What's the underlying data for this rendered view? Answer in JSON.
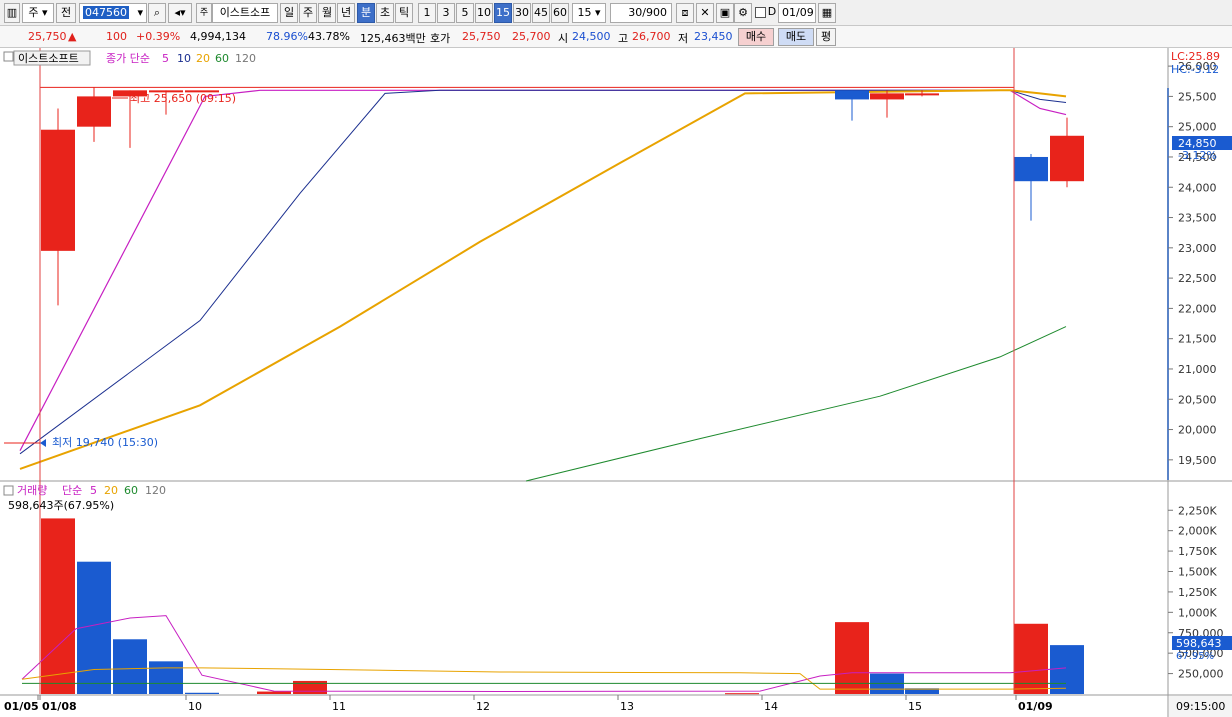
{
  "toolbar": {
    "type_select": "주",
    "prev_label": "전",
    "code_value": "047560",
    "stock_name": "이스트소프",
    "period_tabs": [
      "일",
      "주",
      "월",
      "년",
      "분",
      "초",
      "틱"
    ],
    "active_period": "분",
    "minute_intervals": [
      "1",
      "3",
      "5",
      "10",
      "15",
      "30",
      "45",
      "60"
    ],
    "active_interval": "15",
    "interval_select": "15",
    "count_display": "30/900",
    "date_checkbox_label": "D",
    "date_value": "01/09"
  },
  "quote": {
    "price": "25,750",
    "change": "100",
    "change_pct": "+0.39%",
    "volume": "4,994,134",
    "ratio1": "78.96%",
    "ratio2": "43.78%",
    "amount": "125,463백만",
    "bid_label": "호가",
    "ask_price": "25,750",
    "bid_price": "25,700",
    "open_label": "시",
    "open_price": "24,500",
    "high_label": "고",
    "high_price": "26,700",
    "low_label": "저",
    "low_price": "23,450",
    "buy_label": "매수",
    "sell_label": "매도",
    "eval_label": "평"
  },
  "price_panel": {
    "stock_tag": "이스트소프트",
    "legend_title": "종가 단순",
    "legend_periods": [
      "5",
      "10",
      "20",
      "60",
      "120"
    ],
    "lc_label": "LC:25.89",
    "hc_label": "HC:-3.12",
    "high_annotation": "최고 25,650 (09:15)",
    "low_annotation": "최저 19,740 (15:30)",
    "current_price_box": "24,850",
    "current_change_pct": "-3.12%",
    "y_ticks": [
      "26,000",
      "25,500",
      "25,000",
      "24,500",
      "24,000",
      "23,500",
      "23,000",
      "22,500",
      "22,000",
      "21,500",
      "21,000",
      "20,500",
      "20,000",
      "19,500"
    ]
  },
  "volume_panel": {
    "legend_title": "거래량",
    "legend_sub": "단순",
    "legend_periods": [
      "5",
      "20",
      "60",
      "120"
    ],
    "current_volume": "598,643주(67.95%)",
    "current_volume_box": "598,643",
    "current_volume_pct": "67.95%",
    "y_ticks": [
      "2,250K",
      "2,000K",
      "1,750K",
      "1,500K",
      "1,250K",
      "1,000K",
      "750,000",
      "500,000",
      "250,000"
    ]
  },
  "x_axis": {
    "labels": [
      "01/05",
      "01/08",
      "10",
      "11",
      "12",
      "13",
      "14",
      "15",
      "01/09"
    ],
    "time_label": "09:15:00"
  },
  "colors": {
    "up": "#e8231b",
    "down": "#1a5bd0",
    "ma5": "#c71fc2",
    "ma10": "#1b2f8f",
    "ma20": "#e8a300",
    "ma60": "#1e8a2e",
    "ma120": "#777777"
  },
  "chart_data": [
    {
      "type": "candlestick",
      "title": "이스트소프트",
      "y_range": [
        19200,
        26200
      ],
      "candles": [
        {
          "x": "01/08 09:00",
          "open": 22950,
          "high": 25300,
          "low": 22050,
          "close": 24950
        },
        {
          "x": "01/08 09:15",
          "open": 25000,
          "high": 25650,
          "low": 24750,
          "close": 25500
        },
        {
          "x": "01/08 09:30",
          "open": 25500,
          "high": 25600,
          "low": 24650,
          "close": 25600
        },
        {
          "x": "01/08 15:15",
          "open": 25600,
          "high": 25600,
          "low": 25200,
          "close": 25600
        },
        {
          "x": "01/08 15:30",
          "open": 25600,
          "high": 25600,
          "low": 25600,
          "close": 25600
        },
        {
          "x": "01/08 10:00",
          "open": 25600,
          "high": 25600,
          "low": 25100,
          "close": 25450
        },
        {
          "x": "01/08 10:15",
          "open": 25450,
          "high": 25600,
          "low": 25150,
          "close": 25550
        },
        {
          "x": "01/08 10:30",
          "open": 25550,
          "high": 25600,
          "low": 25500,
          "close": 25550
        },
        {
          "x": "01/09 09:00",
          "open": 24500,
          "high": 24550,
          "low": 23450,
          "close": 24100
        },
        {
          "x": "01/09 09:15",
          "open": 24100,
          "high": 25150,
          "low": 24000,
          "close": 24850
        }
      ],
      "ma_series": [
        {
          "name": "5",
          "values": [
            19650,
            25500,
            25600,
            25600,
            25600,
            25600,
            25600,
            25600,
            25300,
            25200
          ]
        },
        {
          "name": "10",
          "values": [
            19600,
            21800,
            23900,
            25550,
            25600,
            25600,
            25600,
            25600,
            25450,
            25400
          ]
        },
        {
          "name": "20",
          "values": [
            19350,
            20400,
            21700,
            23100,
            24400,
            25550,
            25600,
            25600,
            25550,
            25500
          ]
        },
        {
          "name": "60",
          "values": [
            19150,
            19850,
            20550,
            21200,
            21700
          ]
        }
      ],
      "ylabel": ""
    },
    {
      "type": "bar",
      "title": "거래량",
      "y_range": [
        0,
        2400000
      ],
      "bars": [
        {
          "x": "01/08 09:00",
          "value": 2150000,
          "dir": "up"
        },
        {
          "x": "01/08 09:15",
          "value": 1620000,
          "dir": "down"
        },
        {
          "x": "01/08 09:30",
          "value": 670000,
          "dir": "down"
        },
        {
          "x": "01/08 09:45",
          "value": 400000,
          "dir": "down"
        },
        {
          "x": "01/08 10:00",
          "value": 15000,
          "dir": "down"
        },
        {
          "x": "01/08 14:45",
          "value": 30000,
          "dir": "up"
        },
        {
          "x": "01/08 15:00",
          "value": 160000,
          "dir": "up"
        },
        {
          "x": "01/08 15:30",
          "value": 10000,
          "dir": "up"
        },
        {
          "x": "01/08 14:00",
          "value": 880000,
          "dir": "up"
        },
        {
          "x": "01/08 14:15",
          "value": 250000,
          "dir": "down"
        },
        {
          "x": "01/08 14:30",
          "value": 70000,
          "dir": "down"
        },
        {
          "x": "01/09 09:00",
          "value": 860000,
          "dir": "up"
        },
        {
          "x": "01/09 09:15",
          "value": 598643,
          "dir": "down"
        }
      ],
      "ma_series": [
        {
          "name": "5",
          "values": [
            180000,
            800000,
            930000,
            960000,
            230000,
            35000,
            30000,
            35000,
            220000,
            260000,
            260000,
            260000,
            320000
          ]
        },
        {
          "name": "20",
          "values": [
            180000,
            300000,
            320000,
            320000,
            310000,
            300000,
            270000,
            260000,
            250000,
            60000,
            60000,
            70000
          ]
        },
        {
          "name": "60",
          "values": [
            130000,
            130000,
            130000,
            130000,
            130000,
            130000,
            130000,
            130000
          ]
        }
      ],
      "ylabel": ""
    }
  ]
}
